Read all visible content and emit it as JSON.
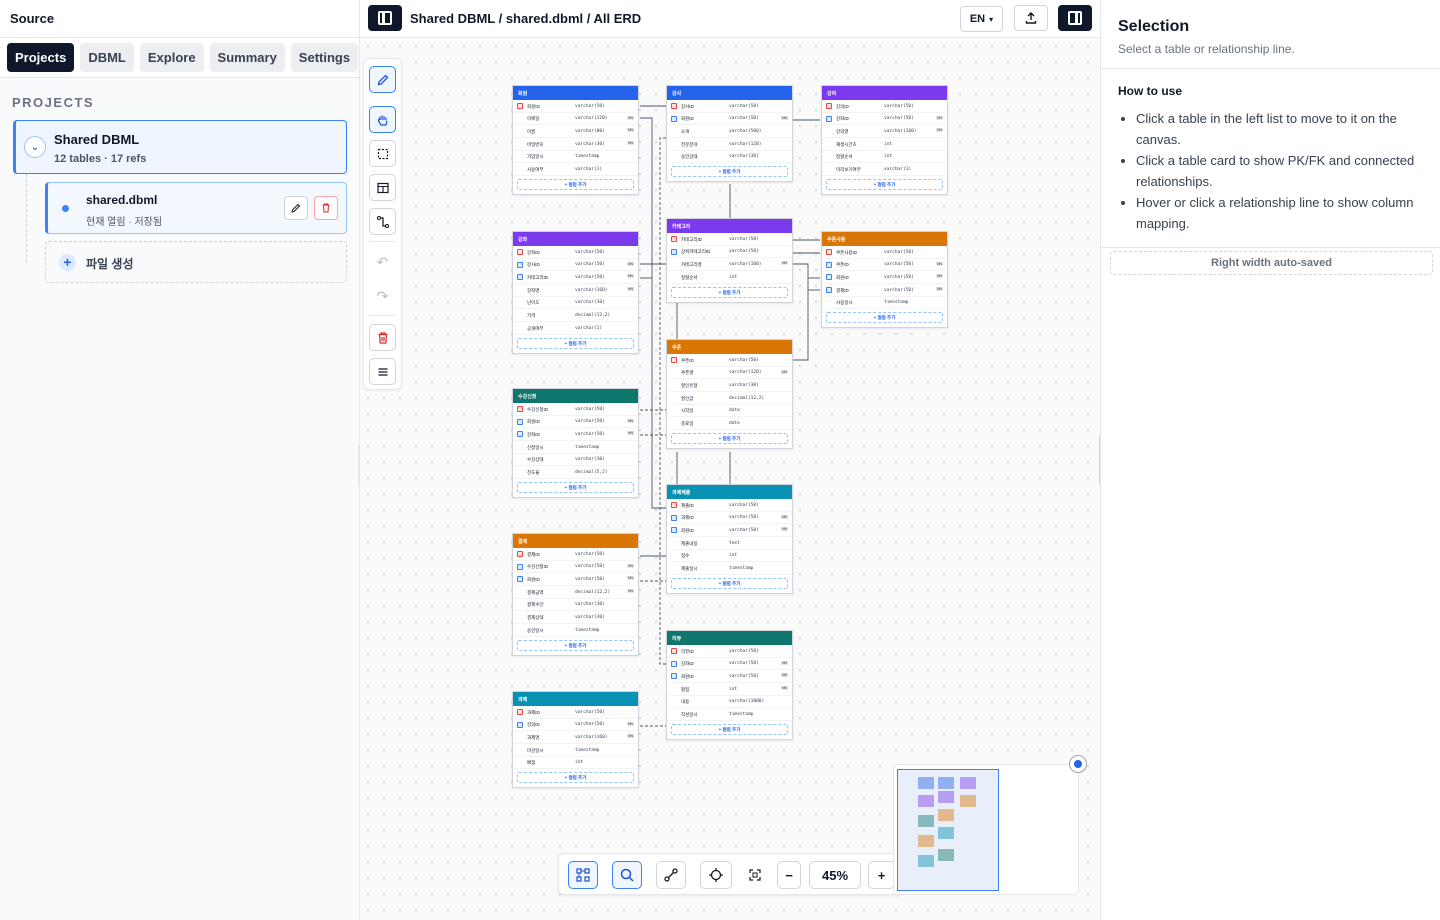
{
  "source_panel": {
    "title": "Source",
    "tabs": [
      "Projects",
      "DBML",
      "Explore",
      "Summary",
      "Settings"
    ],
    "active_tab": "Projects",
    "section_label": "PROJECTS",
    "project": {
      "name": "Shared DBML",
      "meta": "12 tables · 17 refs"
    },
    "file": {
      "name": "shared.dbml",
      "status": "현재 열림 · 저장됨"
    },
    "new_file_label": "파일 생성"
  },
  "header": {
    "breadcrumb": "Shared DBML / shared.dbml / All ERD",
    "language": "EN"
  },
  "tools": {
    "rail": [
      "pencil-icon",
      "hand-icon",
      "select-icon",
      "table-icon",
      "relation-icon",
      "undo-icon",
      "redo-icon",
      "trash-icon",
      "menu-icon"
    ],
    "zoom": "45%"
  },
  "tables": [
    {
      "name": "회원",
      "color": "#2563eb",
      "add_label": "+ 컬럼 추가",
      "columns": [
        [
          "pk",
          "회원ID",
          "varchar(50)",
          false
        ],
        [
          "",
          "이메일",
          "varchar(120)",
          true
        ],
        [
          "",
          "이름",
          "varchar(80)",
          true
        ],
        [
          "",
          "비밀번호",
          "varchar(30)",
          true
        ],
        [
          "",
          "가입일시",
          "timestamp",
          false
        ],
        [
          "",
          "사용여부",
          "varchar(1)",
          false
        ]
      ]
    },
    {
      "name": "강사",
      "color": "#2563eb",
      "add_label": "+ 컬럼 추가",
      "columns": [
        [
          "pk",
          "강사ID",
          "varchar(50)",
          false
        ],
        [
          "fk",
          "회원ID",
          "varchar(50)",
          true
        ],
        [
          "",
          "소개",
          "varchar(500)",
          false
        ],
        [
          "",
          "전문분야",
          "varchar(120)",
          false
        ],
        [
          "",
          "승인상태",
          "varchar(30)",
          false
        ]
      ]
    },
    {
      "name": "강의",
      "color": "#7c3aed",
      "add_label": "+ 컬럼 추가",
      "columns": [
        [
          "pk",
          "강의ID",
          "varchar(50)",
          false
        ],
        [
          "fk",
          "강좌ID",
          "varchar(50)",
          true
        ],
        [
          "",
          "강의명",
          "varchar(160)",
          true
        ],
        [
          "",
          "재생시간초",
          "int",
          false
        ],
        [
          "",
          "정렬순서",
          "int",
          false
        ],
        [
          "",
          "미리보기여부",
          "varchar(1)",
          false
        ]
      ]
    },
    {
      "name": "강좌",
      "color": "#7c3aed",
      "add_label": "+ 컬럼 추가",
      "columns": [
        [
          "pk",
          "강좌ID",
          "varchar(50)",
          false
        ],
        [
          "fk",
          "강사ID",
          "varchar(50)",
          true
        ],
        [
          "fk",
          "카테고리ID",
          "varchar(50)",
          true
        ],
        [
          "",
          "강좌명",
          "varchar(160)",
          true
        ],
        [
          "",
          "난이도",
          "varchar(30)",
          false
        ],
        [
          "",
          "가격",
          "decimal(12,2)",
          false
        ],
        [
          "",
          "공개여부",
          "varchar(1)",
          false
        ]
      ]
    },
    {
      "name": "카테고리",
      "color": "#7c3aed",
      "add_label": "+ 컬럼 추가",
      "columns": [
        [
          "pk",
          "카테고리ID",
          "varchar(50)",
          false
        ],
        [
          "fk",
          "상위카테고리ID",
          "varchar(50)",
          false
        ],
        [
          "",
          "카테고리명",
          "varchar(100)",
          true
        ],
        [
          "",
          "정렬순서",
          "int",
          false
        ]
      ]
    },
    {
      "name": "쿠폰사용",
      "color": "#d97706",
      "add_label": "+ 컬럼 추가",
      "columns": [
        [
          "pk",
          "쿠폰사용ID",
          "varchar(50)",
          false
        ],
        [
          "fk",
          "쿠폰ID",
          "varchar(50)",
          true
        ],
        [
          "fk",
          "회원ID",
          "varchar(50)",
          true
        ],
        [
          "fk",
          "결제ID",
          "varchar(50)",
          true
        ],
        [
          "",
          "사용일시",
          "timestamp",
          false
        ]
      ]
    },
    {
      "name": "쿠폰",
      "color": "#d97706",
      "add_label": "+ 컬럼 추가",
      "columns": [
        [
          "pk",
          "쿠폰ID",
          "varchar(50)",
          false
        ],
        [
          "",
          "쿠폰명",
          "varchar(120)",
          true
        ],
        [
          "",
          "할인유형",
          "varchar(30)",
          false
        ],
        [
          "",
          "할인값",
          "decimal(12,2)",
          false
        ],
        [
          "",
          "시작일",
          "date",
          false
        ],
        [
          "",
          "종료일",
          "date",
          false
        ]
      ]
    },
    {
      "name": "수강신청",
      "color": "#0f766e",
      "add_label": "+ 컬럼 추가",
      "columns": [
        [
          "pk",
          "수강신청ID",
          "varchar(50)",
          false
        ],
        [
          "fk",
          "회원ID",
          "varchar(50)",
          true
        ],
        [
          "fk",
          "강좌ID",
          "varchar(50)",
          true
        ],
        [
          "",
          "신청일시",
          "timestamp",
          false
        ],
        [
          "",
          "수강상태",
          "varchar(30)",
          false
        ],
        [
          "",
          "진도율",
          "decimal(5,2)",
          false
        ]
      ]
    },
    {
      "name": "과제제출",
      "color": "#0891b2",
      "add_label": "+ 컬럼 추가",
      "columns": [
        [
          "pk",
          "제출ID",
          "varchar(50)",
          false
        ],
        [
          "fk",
          "과제ID",
          "varchar(50)",
          true
        ],
        [
          "fk",
          "회원ID",
          "varchar(50)",
          true
        ],
        [
          "",
          "제출내용",
          "text",
          false
        ],
        [
          "",
          "점수",
          "int",
          false
        ],
        [
          "",
          "제출일시",
          "timestamp",
          false
        ]
      ]
    },
    {
      "name": "결제",
      "color": "#d97706",
      "add_label": "+ 컬럼 추가",
      "columns": [
        [
          "pk",
          "결제ID",
          "varchar(50)",
          false
        ],
        [
          "fk",
          "수강신청ID",
          "varchar(50)",
          true
        ],
        [
          "fk",
          "회원ID",
          "varchar(50)",
          true
        ],
        [
          "",
          "결제금액",
          "decimal(12,2)",
          true
        ],
        [
          "",
          "결제수단",
          "varchar(30)",
          false
        ],
        [
          "",
          "결제상태",
          "varchar(30)",
          false
        ],
        [
          "",
          "승인일시",
          "timestamp",
          false
        ]
      ]
    },
    {
      "name": "리뷰",
      "color": "#0f766e",
      "add_label": "+ 컬럼 추가",
      "columns": [
        [
          "pk",
          "리뷰ID",
          "varchar(50)",
          false
        ],
        [
          "fk",
          "강좌ID",
          "varchar(50)",
          true
        ],
        [
          "fk",
          "회원ID",
          "varchar(50)",
          true
        ],
        [
          "",
          "평점",
          "int",
          true
        ],
        [
          "",
          "내용",
          "varchar(1000)",
          false
        ],
        [
          "",
          "작성일시",
          "timestamp",
          false
        ]
      ]
    },
    {
      "name": "과제",
      "color": "#0891b2",
      "add_label": "+ 컬럼 추가",
      "columns": [
        [
          "pk",
          "과제ID",
          "varchar(50)",
          false
        ],
        [
          "fk",
          "강의ID",
          "varchar(50)",
          true
        ],
        [
          "",
          "과제명",
          "varchar(160)",
          true
        ],
        [
          "",
          "마감일시",
          "timestamp",
          false
        ],
        [
          "",
          "배점",
          "int",
          false
        ]
      ]
    }
  ],
  "selection_panel": {
    "title": "Selection",
    "hint": "Select a table or relationship line.",
    "how_to_title": "How to use",
    "how_to": [
      "Click a table in the left list to move to it on the canvas.",
      "Click a table card to show PK/FK and connected relationships.",
      "Hover or click a relationship line to show column mapping."
    ],
    "autosave_label": "Right width auto-saved"
  }
}
